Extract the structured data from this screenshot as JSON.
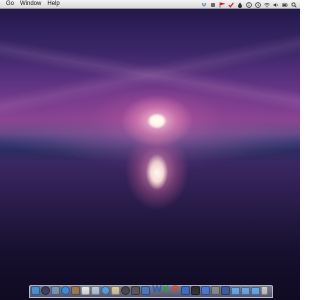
{
  "menubar": {
    "items": [
      {
        "label": "Go"
      },
      {
        "label": "Window"
      },
      {
        "label": "Help"
      }
    ],
    "status_icons": [
      {
        "name": "dropbox-icon",
        "color": "#4a6fb5"
      },
      {
        "name": "app-status-icon",
        "color": "#666666"
      },
      {
        "name": "flag-icon",
        "color": "#cc2222"
      },
      {
        "name": "checkmark-icon",
        "color": "#cc2222"
      },
      {
        "name": "drop-icon",
        "color": "#333333"
      },
      {
        "name": "info-icon",
        "color": "#333333"
      },
      {
        "name": "time-machine-icon",
        "color": "#333333"
      },
      {
        "name": "wifi-icon",
        "color": "#333333"
      },
      {
        "name": "volume-icon",
        "color": "#333333"
      },
      {
        "name": "battery-icon",
        "color": "#333333"
      },
      {
        "name": "search-icon",
        "color": "#333333"
      }
    ]
  },
  "dock": {
    "icons": [
      {
        "name": "finder-icon",
        "color": "#4a90d9"
      },
      {
        "name": "dashboard-icon",
        "color": "#3a3a5a"
      },
      {
        "name": "mail-icon",
        "color": "#7a96b8"
      },
      {
        "name": "safari-icon",
        "color": "#3b8ee0"
      },
      {
        "name": "contacts-icon",
        "color": "#a07850"
      },
      {
        "name": "calendar-icon",
        "color": "#e8e8e8"
      },
      {
        "name": "preview-icon",
        "color": "#b8c8d8"
      },
      {
        "name": "itunes-icon",
        "color": "#5aa0e0"
      },
      {
        "name": "photo-icon",
        "color": "#d8c8a0"
      },
      {
        "name": "dvd-icon",
        "color": "#444444"
      },
      {
        "name": "facetime-icon",
        "color": "#555555"
      },
      {
        "name": "app-store-icon",
        "color": "#4a78c0"
      },
      {
        "name": "word-icon",
        "color": "#2b5fb8"
      },
      {
        "name": "excel-icon",
        "color": "#2f9a3c"
      },
      {
        "name": "powerpoint-icon",
        "color": "#d24a2a"
      },
      {
        "name": "network-icon",
        "color": "#3a6ec0"
      },
      {
        "name": "terminal-icon",
        "color": "#2a2a2a"
      },
      {
        "name": "xcode-icon",
        "color": "#4a78d8"
      },
      {
        "name": "system-preferences-icon",
        "color": "#8a8a8a"
      },
      {
        "name": "activity-icon",
        "color": "#3a5aa0"
      },
      {
        "name": "downloads-folder-icon",
        "color": "#6aa8e8"
      },
      {
        "name": "documents-folder-icon",
        "color": "#6aa8e8"
      },
      {
        "name": "applications-folder-icon",
        "color": "#6aa8e8"
      },
      {
        "name": "trash-icon",
        "color": "#c8c8c8"
      }
    ],
    "text_glyphs": {
      "word": "W",
      "excel": "X",
      "powerpoint": "P"
    }
  }
}
